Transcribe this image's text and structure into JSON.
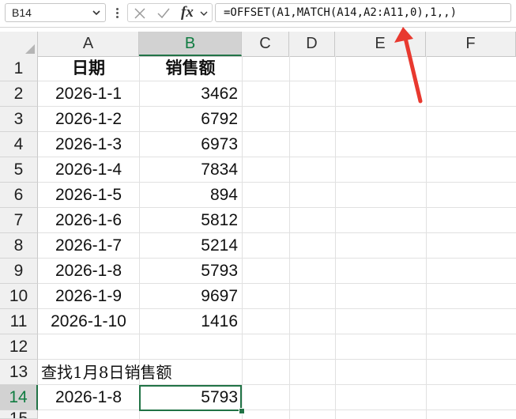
{
  "formula_bar": {
    "name_box": "B14",
    "fx_label": "fx",
    "formula": "=OFFSET(A1,MATCH(A14,A2:A11,0),1,,)"
  },
  "columns": [
    "A",
    "B",
    "C",
    "D",
    "E",
    "F"
  ],
  "active_column": "B",
  "rows": [
    "1",
    "2",
    "3",
    "4",
    "5",
    "6",
    "7",
    "8",
    "9",
    "10",
    "11",
    "12",
    "13",
    "14",
    "15"
  ],
  "active_row": "14",
  "table": {
    "headers": [
      "日期",
      "销售额"
    ],
    "data": [
      [
        "2026-1-1",
        "3462"
      ],
      [
        "2026-1-2",
        "6792"
      ],
      [
        "2026-1-3",
        "6973"
      ],
      [
        "2026-1-4",
        "7834"
      ],
      [
        "2026-1-5",
        "894"
      ],
      [
        "2026-1-6",
        "5812"
      ],
      [
        "2026-1-7",
        "5214"
      ],
      [
        "2026-1-8",
        "5793"
      ],
      [
        "2026-1-9",
        "9697"
      ],
      [
        "2026-1-10",
        "1416"
      ]
    ]
  },
  "lookup": {
    "prompt": "查找1月8日销售额",
    "key": "2026-1-8",
    "result": "5793"
  },
  "colors": {
    "accent": "#217346",
    "arrow": "#e8392f",
    "header_bg": "#f0f0f0"
  }
}
